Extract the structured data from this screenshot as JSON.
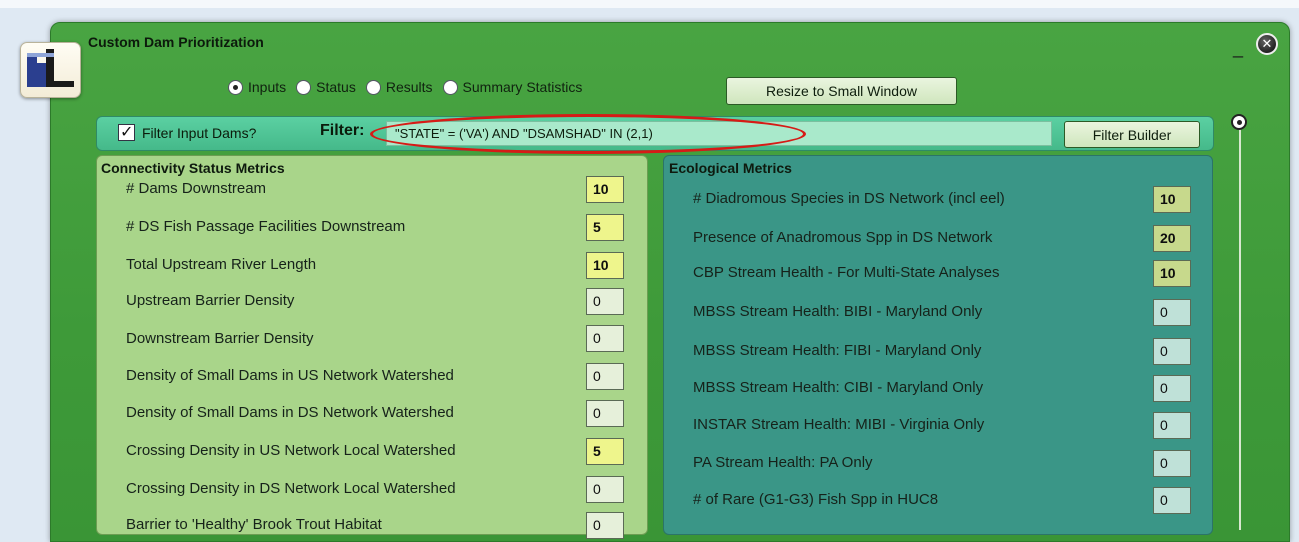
{
  "window": {
    "title": "Custom Dam Prioritization"
  },
  "tabs": [
    {
      "label": "Inputs",
      "selected": true
    },
    {
      "label": "Status",
      "selected": false
    },
    {
      "label": "Results",
      "selected": false
    },
    {
      "label": "Summary Statistics",
      "selected": false
    }
  ],
  "resize_button": "Resize to Small Window",
  "filter": {
    "checkbox_label": "Filter Input Dams?",
    "checked": true,
    "label": "Filter:",
    "value": "\"STATE\" = ('VA') AND \"DSAMSHAD\" IN (2,1)",
    "builder_button": "Filter Builder"
  },
  "connectivity": {
    "title": "Connectivity Status Metrics",
    "metrics": [
      {
        "label": "# Dams Downstream",
        "value": "10"
      },
      {
        "label": "# DS Fish Passage Facilities Downstream",
        "value": "5"
      },
      {
        "label": "Total Upstream River Length",
        "value": "10"
      },
      {
        "label": "Upstream Barrier Density",
        "value": "0"
      },
      {
        "label": "Downstream Barrier Density",
        "value": "0"
      },
      {
        "label": "Density of Small Dams in US Network Watershed",
        "value": "0"
      },
      {
        "label": "Density of Small Dams in DS Network Watershed",
        "value": "0"
      },
      {
        "label": "Crossing Density in US Network Local Watershed",
        "value": "5"
      },
      {
        "label": "Crossing Density in DS Network Local Watershed",
        "value": "0"
      },
      {
        "label": "Barrier to 'Healthy' Brook Trout Habitat",
        "value": "0"
      }
    ]
  },
  "ecological": {
    "title": "Ecological Metrics",
    "metrics": [
      {
        "label": "# Diadromous Species in DS Network (incl eel)",
        "value": "10"
      },
      {
        "label": "Presence of Anadromous Spp in DS Network",
        "value": "20"
      },
      {
        "label": "CBP Stream Health - For Multi-State Analyses",
        "value": "10"
      },
      {
        "label": "MBSS Stream Health: BIBI - Maryland Only",
        "value": "0"
      },
      {
        "label": "MBSS Stream Health: FIBI - Maryland Only",
        "value": "0"
      },
      {
        "label": "MBSS Stream Health: CIBI - Maryland Only",
        "value": "0"
      },
      {
        "label": "INSTAR Stream Health: MIBI - Virginia Only",
        "value": "0"
      },
      {
        "label": "PA Stream Health: PA Only",
        "value": "0"
      },
      {
        "label": "# of Rare (G1-G3) Fish Spp in HUC8",
        "value": "0"
      }
    ]
  }
}
